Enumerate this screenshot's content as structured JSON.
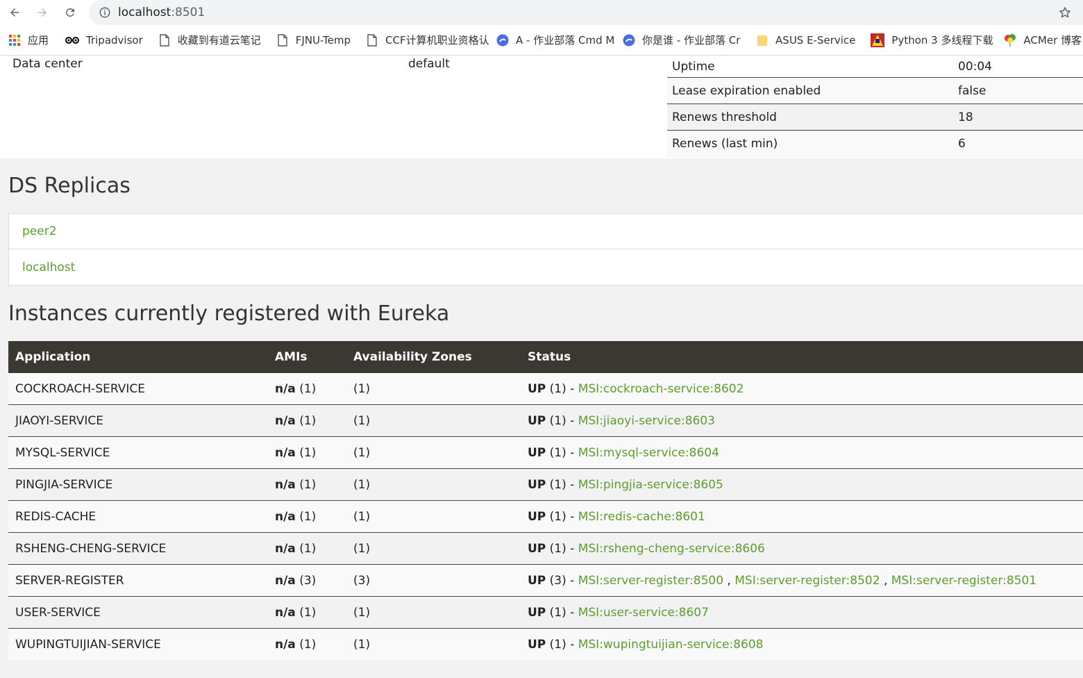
{
  "browser": {
    "url_host": "localhost",
    "url_port": ":8501"
  },
  "bookmarks": [
    {
      "label": "应用",
      "icon": "apps-grid-icon"
    },
    {
      "label": "Tripadvisor",
      "icon": "tripadvisor-owl-icon"
    },
    {
      "label": "收藏到有道云笔记",
      "icon": "page-icon"
    },
    {
      "label": "FJNU-Temp",
      "icon": "page-icon"
    },
    {
      "label": "CCF计算机职业资格认",
      "icon": "page-icon"
    },
    {
      "label": "A - 作业部落 Cmd M",
      "icon": "cmd-markdown-icon"
    },
    {
      "label": "你是谁 - 作业部落 Cr",
      "icon": "cmd-markdown-icon"
    },
    {
      "label": "ASUS E-Service",
      "icon": "folder-icon"
    },
    {
      "label": "Python 3 多线程下载",
      "icon": "python-icon"
    },
    {
      "label": "ACMer 博客",
      "icon": "balloon-icon"
    }
  ],
  "general": {
    "data_center_label": "Data center",
    "data_center_value": "default"
  },
  "stats": [
    {
      "key": "Uptime",
      "value": "00:04"
    },
    {
      "key": "Lease expiration enabled",
      "value": "false"
    },
    {
      "key": "Renews threshold",
      "value": "18"
    },
    {
      "key": "Renews (last min)",
      "value": "6"
    }
  ],
  "replicas": {
    "title": "DS Replicas",
    "items": [
      "peer2",
      "localhost"
    ]
  },
  "instances": {
    "title": "Instances currently registered with Eureka",
    "headers": [
      "Application",
      "AMIs",
      "Availability Zones",
      "Status"
    ],
    "rows": [
      {
        "app": "COCKROACH-SERVICE",
        "ami": "n/a",
        "ami_count": "(1)",
        "zones": "(1)",
        "status": "UP",
        "status_count": "(1) -",
        "links": [
          "MSI:cockroach-service:8602"
        ]
      },
      {
        "app": "JIAOYI-SERVICE",
        "ami": "n/a",
        "ami_count": "(1)",
        "zones": "(1)",
        "status": "UP",
        "status_count": "(1) -",
        "links": [
          "MSI:jiaoyi-service:8603"
        ]
      },
      {
        "app": "MYSQL-SERVICE",
        "ami": "n/a",
        "ami_count": "(1)",
        "zones": "(1)",
        "status": "UP",
        "status_count": "(1) -",
        "links": [
          "MSI:mysql-service:8604"
        ]
      },
      {
        "app": "PINGJIA-SERVICE",
        "ami": "n/a",
        "ami_count": "(1)",
        "zones": "(1)",
        "status": "UP",
        "status_count": "(1) -",
        "links": [
          "MSI:pingjia-service:8605"
        ]
      },
      {
        "app": "REDIS-CACHE",
        "ami": "n/a",
        "ami_count": "(1)",
        "zones": "(1)",
        "status": "UP",
        "status_count": "(1) -",
        "links": [
          "MSI:redis-cache:8601"
        ]
      },
      {
        "app": "RSHENG-CHENG-SERVICE",
        "ami": "n/a",
        "ami_count": "(1)",
        "zones": "(1)",
        "status": "UP",
        "status_count": "(1) -",
        "links": [
          "MSI:rsheng-cheng-service:8606"
        ]
      },
      {
        "app": "SERVER-REGISTER",
        "ami": "n/a",
        "ami_count": "(3)",
        "zones": "(3)",
        "status": "UP",
        "status_count": "(3) -",
        "links": [
          "MSI:server-register:8500",
          "MSI:server-register:8502",
          "MSI:server-register:8501"
        ]
      },
      {
        "app": "USER-SERVICE",
        "ami": "n/a",
        "ami_count": "(1)",
        "zones": "(1)",
        "status": "UP",
        "status_count": "(1) -",
        "links": [
          "MSI:user-service:8607"
        ]
      },
      {
        "app": "WUPINGTUIJIAN-SERVICE",
        "ami": "n/a",
        "ami_count": "(1)",
        "zones": "(1)",
        "status": "UP",
        "status_count": "(1) -",
        "links": [
          "MSI:wupingtuijian-service:8608"
        ]
      }
    ]
  },
  "colors": {
    "link": "#5a9e2f",
    "table_header_bg": "#3b3731"
  }
}
